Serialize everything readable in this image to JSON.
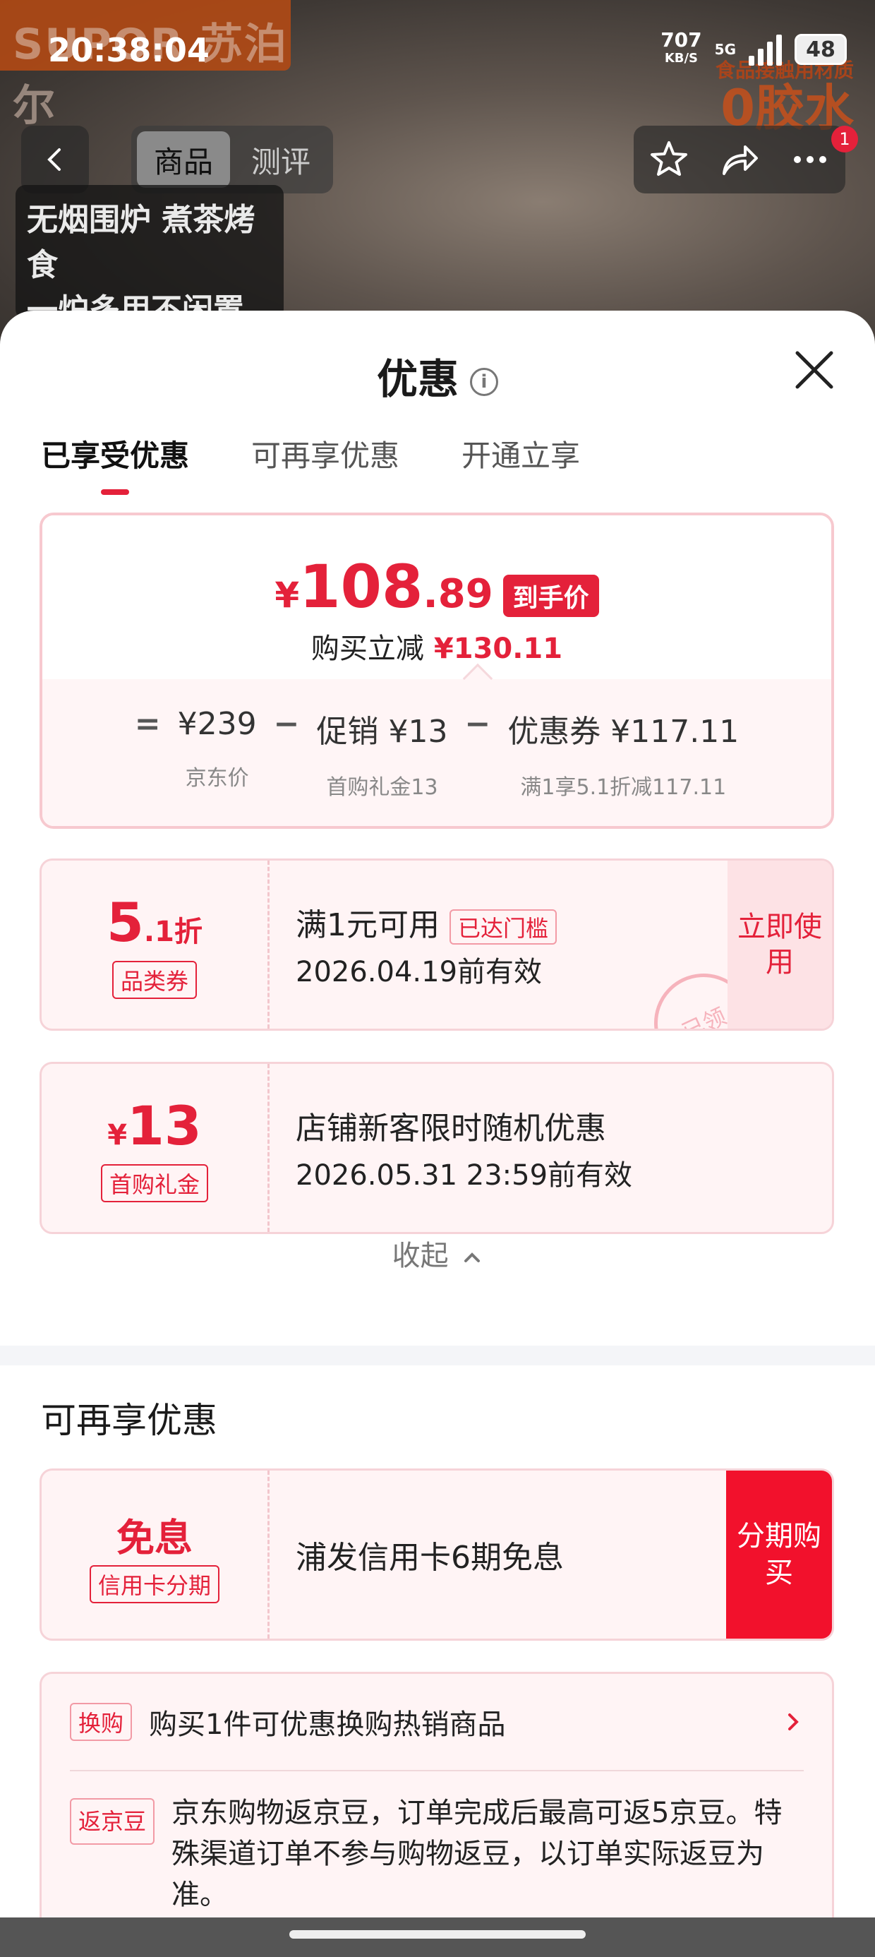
{
  "status_bar": {
    "time": "20:38:04",
    "speed": "707",
    "speed_unit": "KB/S",
    "network": "5G",
    "battery": "48"
  },
  "background": {
    "brand": "SUPOR 苏泊尔",
    "promo_small": "食品接触用材质",
    "promo_big": "0胶水",
    "slogan_line1": "无烟围炉 煮茶烤食",
    "slogan_line2": "一炉多用不闲置"
  },
  "nav": {
    "tabs": [
      "商品",
      "测评"
    ],
    "badge_count": "1"
  },
  "sheet": {
    "title": "优惠",
    "tabs": [
      "已享受优惠",
      "可再享优惠",
      "开通立享"
    ],
    "price": {
      "currency": "¥",
      "integer": "108",
      "decimal": ".89",
      "tag": "到手价",
      "reduce_label": "购买立减",
      "reduce_value": "¥130.11"
    },
    "formula": {
      "eq": "=",
      "minus": "−",
      "jd_price": "¥239",
      "jd_price_label": "京东价",
      "promo": "促销 ¥13",
      "promo_label": "首购礼金13",
      "coupon": "优惠券 ¥117.11",
      "coupon_label": "满1享5.1折减117.11"
    },
    "coupon1": {
      "value_int": "5",
      "value_dec": ".1折",
      "tag": "品类券",
      "condition": "满1元可用",
      "threshold": "已达门槛",
      "expiry": "2026.04.19前有效",
      "action": "立即使用",
      "stamp": "已领"
    },
    "coupon2": {
      "currency": "¥",
      "value": "13",
      "tag": "首购礼金",
      "title": "店铺新客限时随机优惠",
      "expiry": "2026.05.31 23:59前有效"
    },
    "collapse_label": "收起",
    "more_section_title": "可再享优惠",
    "installment": {
      "title": "免息",
      "tag": "信用卡分期",
      "desc": "浦发信用卡6期免息",
      "action": "分期购买"
    },
    "swap": {
      "tag": "换购",
      "text": "购买1件可优惠换购热销商品"
    },
    "jingdou": {
      "tag": "返京豆",
      "text": "京东购物返京豆，订单完成后最高可返5京豆。特殊渠道订单不参与购物返豆，以订单实际返豆为准。"
    }
  },
  "colors": {
    "accent": "#e4213a",
    "accent_bright": "#f2112c",
    "coupon_bg": "#fff4f5"
  }
}
